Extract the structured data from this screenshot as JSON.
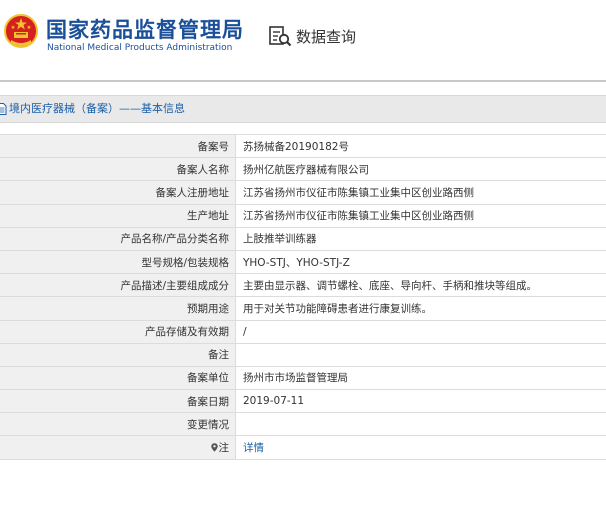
{
  "header": {
    "title_cn": "国家药品监督管理局",
    "title_en": "National Medical Products Administration",
    "query_label": "数据查询"
  },
  "section": {
    "title": "境内医疗器械（备案）——基本信息"
  },
  "rows": [
    {
      "label": "备案号",
      "value": "苏扬械备20190182号"
    },
    {
      "label": "备案人名称",
      "value": "扬州亿航医疗器械有限公司"
    },
    {
      "label": "备案人注册地址",
      "value": "江苏省扬州市仪征市陈集镇工业集中区创业路西侧"
    },
    {
      "label": "生产地址",
      "value": "江苏省扬州市仪征市陈集镇工业集中区创业路西侧"
    },
    {
      "label": "产品名称/产品分类名称",
      "value": "上肢推举训练器"
    },
    {
      "label": "型号规格/包装规格",
      "value": "YHO-STJ、YHO-STJ-Z"
    },
    {
      "label": "产品描述/主要组成成分",
      "value": "主要由显示器、调节螺栓、底座、导向杆、手柄和推块等组成。"
    },
    {
      "label": "预期用途",
      "value": "用于对关节功能障碍患者进行康复训练。"
    },
    {
      "label": "产品存储及有效期",
      "value": "/"
    },
    {
      "label": "备注",
      "value": ""
    },
    {
      "label": "备案单位",
      "value": "扬州市市场监督管理局"
    },
    {
      "label": "备案日期",
      "value": "2019-07-11"
    },
    {
      "label": "变更情况",
      "value": ""
    },
    {
      "label": "注",
      "value": "详情"
    }
  ],
  "colors": {
    "brand_blue": "#1a4f99",
    "link_blue": "#1a5fa8",
    "emblem_red": "#d62020",
    "emblem_gold": "#f2c230"
  },
  "icons": [
    "national-emblem-icon",
    "search-doc-icon",
    "document-icon",
    "location-pin-icon"
  ]
}
